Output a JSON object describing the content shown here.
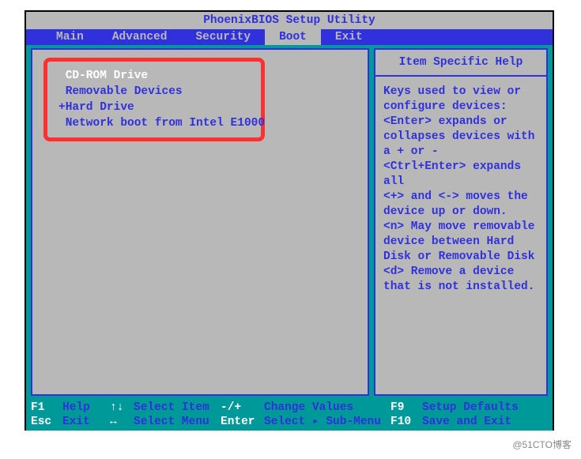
{
  "title": "PhoenixBIOS Setup Utility",
  "tabs": {
    "main": "Main",
    "advanced": "Advanced",
    "security": "Security",
    "boot": "Boot",
    "exit": "Exit"
  },
  "active_tab": "boot",
  "boot_order": [
    {
      "label": "CD-ROM Drive",
      "prefix": " ",
      "selected": true
    },
    {
      "label": "Removable Devices",
      "prefix": " ",
      "selected": false
    },
    {
      "label": "Hard Drive",
      "prefix": "+",
      "selected": false
    },
    {
      "label": "Network boot from Intel E1000",
      "prefix": " ",
      "selected": false
    }
  ],
  "help": {
    "title": "Item Specific Help",
    "body": "Keys used to view or configure devices:\n<Enter> expands or collapses devices with a + or -\n<Ctrl+Enter> expands all\n<+> and <-> moves the device up or down.\n<n> May move removable device between Hard Disk or Removable Disk\n<d> Remove a device that is not installed."
  },
  "footer": {
    "r1": {
      "k1": "F1",
      "l1": "Help",
      "k2": "↑↓",
      "l2": "Select Item",
      "k3": "-/+",
      "l3": "Change Values",
      "k4": "F9",
      "l4": "Setup Defaults"
    },
    "r2": {
      "k1": "Esc",
      "l1": "Exit",
      "k2": "↔",
      "l2": "Select Menu",
      "k3": "Enter",
      "l3": "Select ▸ Sub-Menu",
      "k4": "F10",
      "l4": "Save and Exit"
    }
  },
  "watermark": "@51CTO博客"
}
